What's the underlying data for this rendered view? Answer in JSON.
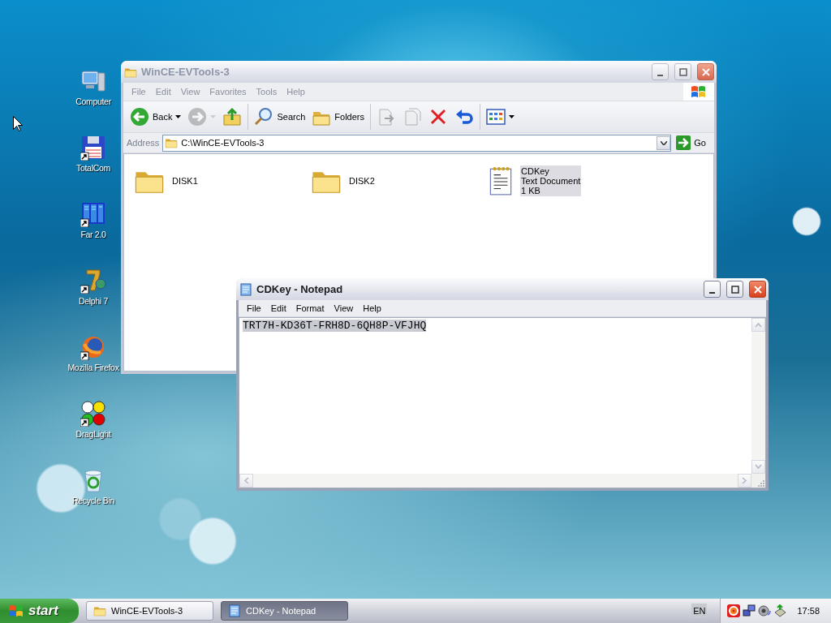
{
  "desktop_icons": [
    {
      "label": "Computer",
      "kind": "computer",
      "shortcut": false
    },
    {
      "label": "TotalCom",
      "kind": "floppy",
      "shortcut": true
    },
    {
      "label": "Far 2.0",
      "kind": "server",
      "shortcut": true
    },
    {
      "label": "Delphi 7",
      "kind": "pillar",
      "shortcut": true
    },
    {
      "label": "Mozilla Firefox",
      "kind": "fox",
      "shortcut": true
    },
    {
      "label": "DragLight",
      "kind": "lights",
      "shortcut": true
    },
    {
      "label": "Recycle Bin",
      "kind": "recycle",
      "shortcut": false
    }
  ],
  "explorer_window": {
    "title": "WinCE-EVTools-3",
    "active": false,
    "menu": [
      "File",
      "Edit",
      "View",
      "Favorites",
      "Tools",
      "Help"
    ],
    "toolbar": [
      {
        "kind": "back",
        "label": "Back",
        "dropdown": true,
        "disabled": false
      },
      {
        "kind": "forward",
        "dropdown": true,
        "disabled": true
      },
      {
        "kind": "up",
        "dropdown": false,
        "disabled": false
      },
      {
        "kind": "separator"
      },
      {
        "kind": "search",
        "label": "Search",
        "dropdown": false,
        "disabled": false
      },
      {
        "kind": "folders",
        "label": "Folders",
        "dropdown": false,
        "disabled": false
      },
      {
        "kind": "separator"
      },
      {
        "kind": "move",
        "dropdown": false,
        "disabled": true
      },
      {
        "kind": "copy",
        "dropdown": false,
        "disabled": true
      },
      {
        "kind": "delete",
        "dropdown": false,
        "disabled": false
      },
      {
        "kind": "undo",
        "dropdown": false,
        "disabled": false
      },
      {
        "kind": "separator"
      },
      {
        "kind": "views",
        "dropdown": true,
        "disabled": false
      }
    ],
    "address": {
      "label": "Address",
      "value": "C:\\WinCE-EVTools-3",
      "go": "Go"
    },
    "items": [
      {
        "name": "DISK1",
        "kind": "folder",
        "selected": false
      },
      {
        "name": "DISK2",
        "kind": "folder",
        "selected": false
      },
      {
        "name": "CDKey",
        "kind": "document",
        "type": "Text Document",
        "size": "1 KB",
        "selected": true
      }
    ]
  },
  "notepad_window": {
    "title": "CDKey - Notepad",
    "active": true,
    "menu": [
      "File",
      "Edit",
      "Format",
      "View",
      "Help"
    ],
    "document": {
      "text": "TRT7H-KD36T-FRH8D-6QH8P-VFJHQ",
      "selected": true
    }
  },
  "taskbar": {
    "start": "start",
    "tasks": [
      {
        "label": "WinCE-EVTools-3",
        "kind": "folder",
        "selected": false
      },
      {
        "label": "CDKey - Notepad",
        "kind": "notepad",
        "selected": true
      }
    ],
    "language": "EN",
    "tray": [
      {
        "kind": "target"
      },
      {
        "kind": "network"
      },
      {
        "kind": "speaker"
      },
      {
        "kind": "device"
      }
    ],
    "clock": "17:58"
  }
}
